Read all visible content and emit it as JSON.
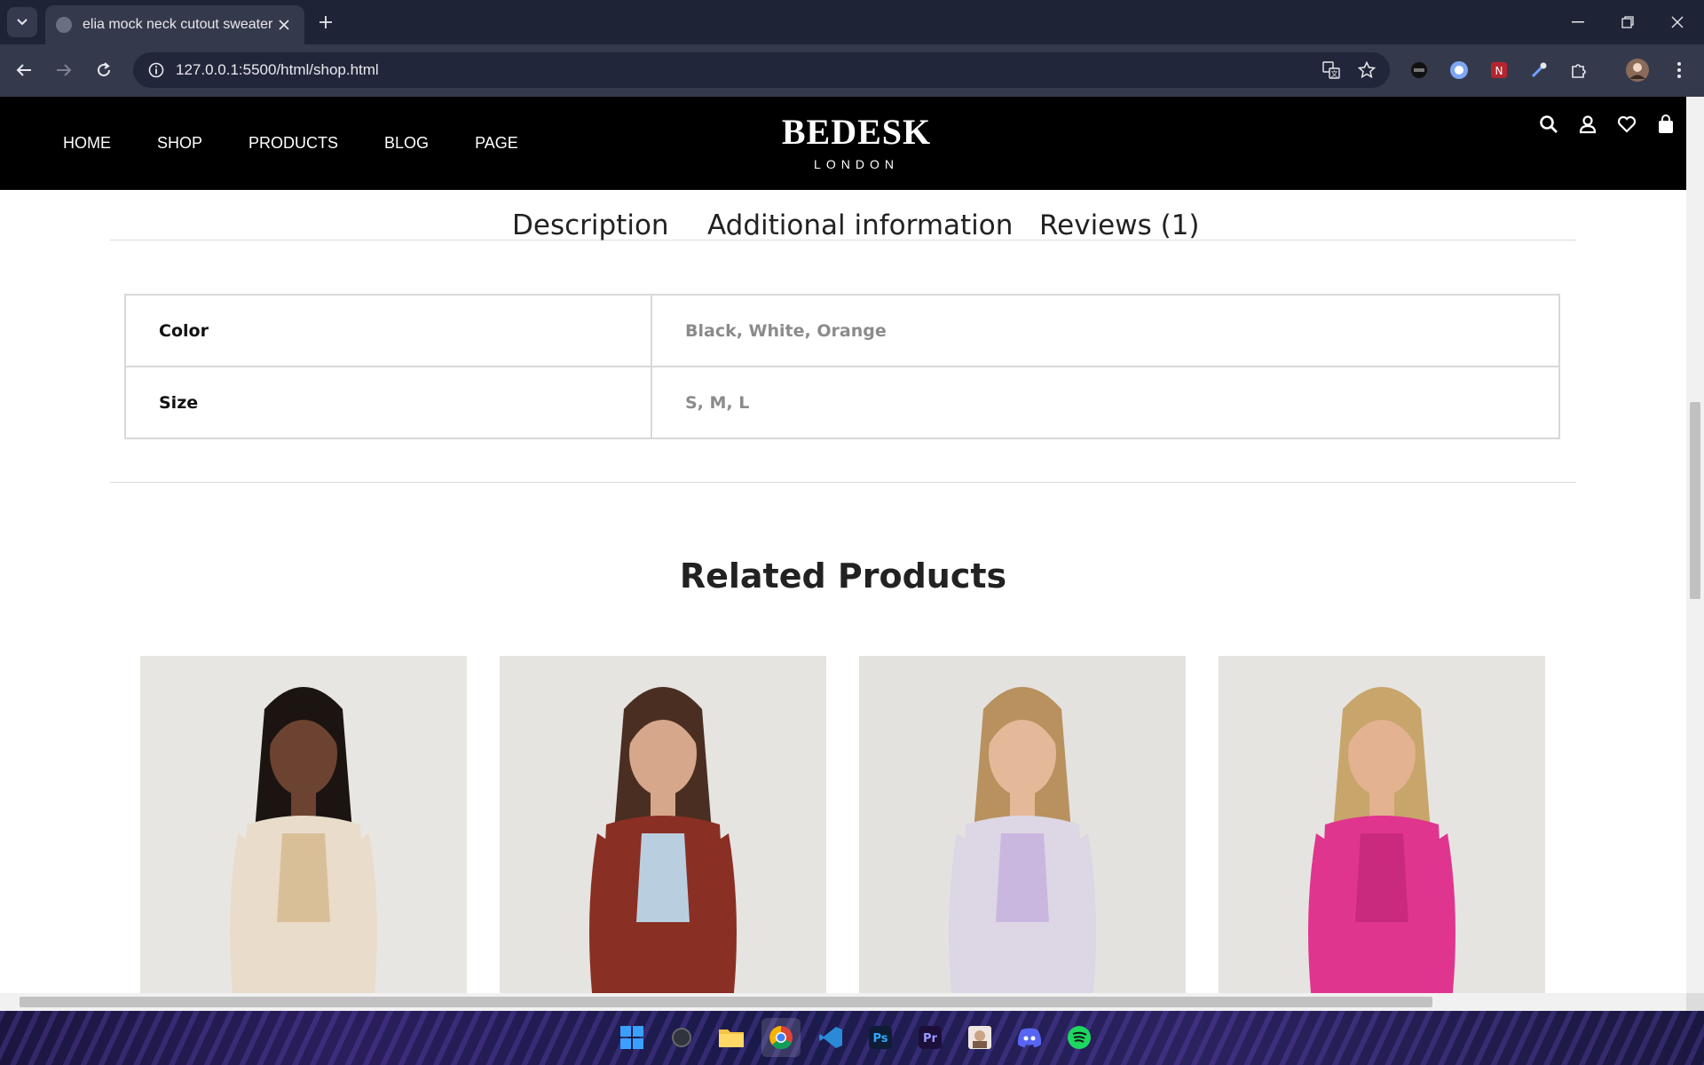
{
  "browser": {
    "tab_title": "elia mock neck cutout sweater",
    "url": "127.0.0.1:5500/html/shop.html"
  },
  "site": {
    "nav": [
      "HOME",
      "SHOP",
      "PRODUCTS",
      "BLOG",
      "PAGE"
    ],
    "logo": "BEDESK",
    "logo_sub": "LONDON"
  },
  "product_tabs": {
    "description": "Description",
    "additional": "Additional information",
    "reviews": "Reviews (1)"
  },
  "attributes": [
    {
      "label": "Color",
      "value": "Black, White, Orange"
    },
    {
      "label": "Size",
      "value": "S, M, L"
    }
  ],
  "related": {
    "title": "Related Products",
    "products": [
      {
        "image": "cream sherpa jacket with beige top",
        "colors": {
          "bg": "#e8e6e3",
          "main": "#e9dccb",
          "accent": "#d9bf98",
          "skin": "#6b4330",
          "hair": "#1b1411"
        }
      },
      {
        "image": "red sleeveless cropped shirt with denim shorts",
        "colors": {
          "bg": "#e6e4e1",
          "main": "#8a2f24",
          "accent": "#b9cfe0",
          "skin": "#d6a78a",
          "hair": "#4a2e22"
        }
      },
      {
        "image": "pastel plaid cardigan and bralette set",
        "colors": {
          "bg": "#e4e2df",
          "main": "#ddd6e4",
          "accent": "#c9b7e0",
          "skin": "#e3b99a",
          "hair": "#b8915e"
        }
      },
      {
        "image": "pink spaghetti strap midi dress",
        "colors": {
          "bg": "#e6e4e1",
          "main": "#e0358f",
          "accent": "#c92a7e",
          "skin": "#e2b291",
          "hair": "#c8a56a"
        }
      }
    ]
  },
  "colors": {
    "header_bg": "#000000",
    "chrome_dark": "#1f2336",
    "chrome_mid": "#35394c"
  }
}
